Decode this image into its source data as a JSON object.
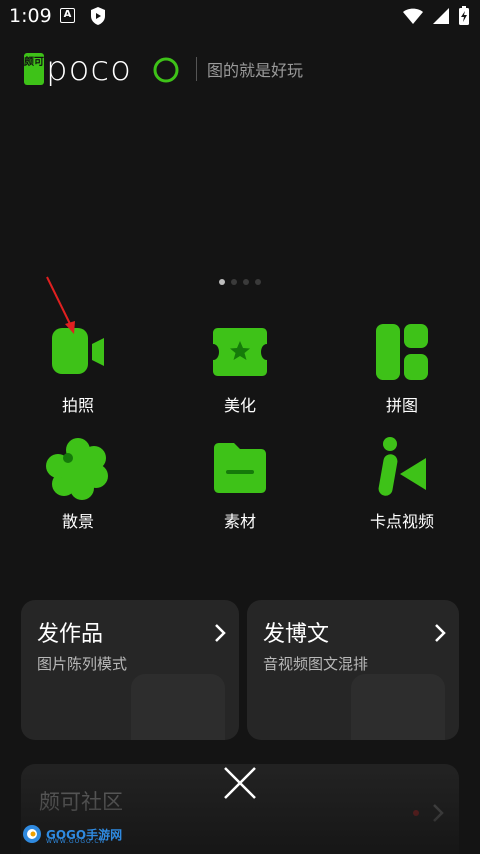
{
  "status_bar": {
    "time": "1:09",
    "icons": [
      "a-badge-icon",
      "shield-icon",
      "wifi-icon",
      "signal-icon",
      "battery-charging-icon"
    ]
  },
  "header": {
    "logo_badge": "颇可",
    "logo_word": "POCO",
    "tagline": "图的就是好玩"
  },
  "pager": {
    "pages": 4,
    "active_index": 0
  },
  "features": [
    {
      "label": "拍照",
      "icon": "camera-video-icon"
    },
    {
      "label": "美化",
      "icon": "star-ticket-icon"
    },
    {
      "label": "拼图",
      "icon": "collage-grid-icon"
    },
    {
      "label": "散景",
      "icon": "bokeh-flower-icon"
    },
    {
      "label": "素材",
      "icon": "folder-icon"
    },
    {
      "label": "卡点视频",
      "icon": "beat-video-icon"
    }
  ],
  "cards": [
    {
      "title": "发作品",
      "subtitle": "图片陈列模式"
    },
    {
      "title": "发博文",
      "subtitle": "音视频图文混排"
    }
  ],
  "community": {
    "title": "颇可社区"
  },
  "watermark": {
    "brand": "GOGO手游网",
    "domain": "WWW.GOGO.CN"
  },
  "colors": {
    "accent": "#3ec218",
    "background": "#141414",
    "card": "#262626",
    "pointer": "#e02020"
  }
}
